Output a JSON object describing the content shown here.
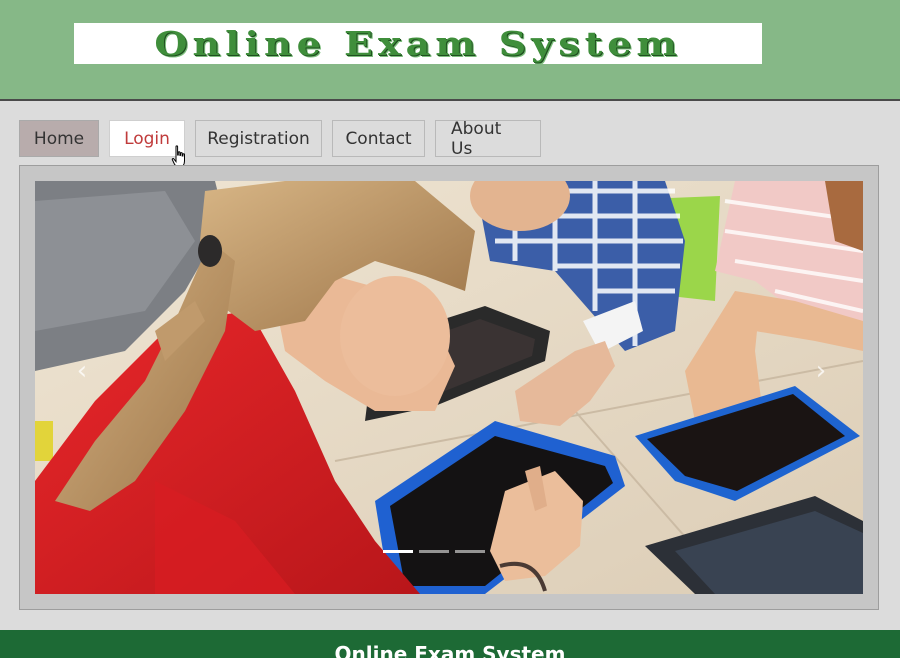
{
  "header": {
    "logo_text": "Online Exam System"
  },
  "nav": {
    "items": [
      {
        "label": "Home",
        "state": "active"
      },
      {
        "label": "Login",
        "state": "hover"
      },
      {
        "label": "Registration"
      },
      {
        "label": "Contact"
      },
      {
        "label": "About Us"
      }
    ]
  },
  "carousel": {
    "prev_icon": "chevron-left-icon",
    "next_icon": "chevron-right-icon",
    "prev_glyph": "‹",
    "next_glyph": "›",
    "slide_count": 3,
    "active_slide": 1
  },
  "footer": {
    "title": "Online Exam System"
  },
  "colors": {
    "header_bg": "#86b887",
    "logo_text": "#3f8e3b",
    "footer_bg": "#1d6a35",
    "login_hover_text": "#c03b3b",
    "home_active_bg": "#b8acac"
  }
}
